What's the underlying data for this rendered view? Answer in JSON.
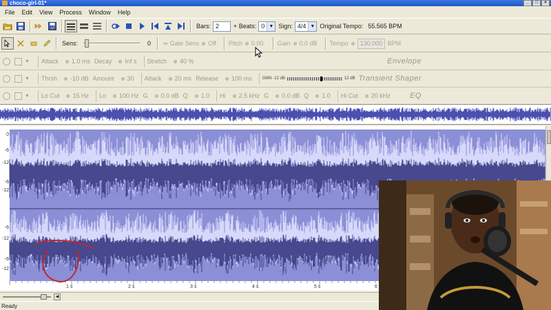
{
  "window": {
    "title": "choco-girl-01*"
  },
  "menu": [
    "File",
    "Edit",
    "View",
    "Process",
    "Window",
    "Help"
  ],
  "toolbar": {
    "bars_label": "Bars:",
    "bars_value": "2",
    "beats_label": "+ Beats:",
    "beats_value": "0",
    "sign_label": "Sign:",
    "sign_value": "4/4",
    "tempo_label": "Original Tempo:",
    "tempo_value": "55.565 BPM"
  },
  "toolbar2": {
    "sens_label": "Sens:",
    "sens_value": "0",
    "gate_sens_label": "Gate Sens",
    "gate_sens_value": "Off",
    "pitch_label": "Pitch",
    "pitch_value": "0.00",
    "gain_label": "Gain",
    "gain_value": "0.0 dB",
    "tempo_label": "Tempo",
    "tempo_value": "130.000",
    "tempo_unit": "BPM"
  },
  "envelope": {
    "title": "Envelope",
    "attack_label": "Attack",
    "attack_value": "1.0 ms",
    "decay_label": "Decay",
    "decay_value": "Inf s",
    "stretch_label": "Stretch",
    "stretch_value": "40 %"
  },
  "transient": {
    "title": "Transient Shaper",
    "thrsh_label": "Thrsh",
    "thrsh_value": "-10 dB",
    "amount_label": "Amount",
    "amount_value": "30",
    "attack_label": "Attack",
    "attack_value": "20 ms",
    "release_label": "Release",
    "release_value": "100 ms",
    "meter_left": "GMN -12 dB",
    "meter_right": "12 dB"
  },
  "eq": {
    "title": "EQ",
    "locut_label": "Lo Cut",
    "locut_value": "15 Hz",
    "lo_label": "Lo",
    "lo_freq": "100 Hz",
    "lo_g_label": "G",
    "lo_gain": "0.0 dB",
    "lo_q_label": "Q",
    "lo_q": "1.0",
    "hi_label": "Hi",
    "hi_freq": "2.5 kHz",
    "hi_g_label": "G",
    "hi_gain": "0.0 dB",
    "hi_q_label": "Q",
    "hi_q": "1.0",
    "hicut_label": "Hi Cut",
    "hicut_value": "20 kHz"
  },
  "waveform": {
    "db_ticks_top": [
      "0",
      "-6",
      "-12",
      "-6",
      "-12"
    ],
    "db_ticks_bottom": [
      "-6",
      "-12",
      "-6",
      "-12"
    ],
    "time_ticks": [
      "1 s",
      "2 s",
      "3 s",
      "4 s",
      "5 s",
      "6"
    ],
    "colors": {
      "bg": "#8b8fd6",
      "wave_dark": "#2f2f7a",
      "wave_light": "#e0e2ff",
      "overview": "#4b4fb0"
    }
  },
  "statusbar": {
    "text": "Ready"
  }
}
